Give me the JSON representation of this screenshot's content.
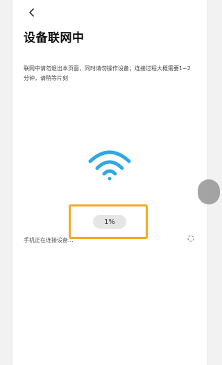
{
  "header": {
    "title": "设备联网中"
  },
  "description": "联网中请勿退出本页面，同时请勿操作设备；连接过程大概需要1~2分钟，请稍等片刻",
  "progress": {
    "label": "1%",
    "value_percent": 1
  },
  "status": {
    "text": "手机正在连接设备..."
  },
  "colors": {
    "wifi": "#2fa8e3",
    "highlight": "#f3a922"
  },
  "icons": {
    "back": "back-arrow-icon",
    "wifi": "wifi-icon",
    "spinner": "loading-spinner-icon"
  }
}
